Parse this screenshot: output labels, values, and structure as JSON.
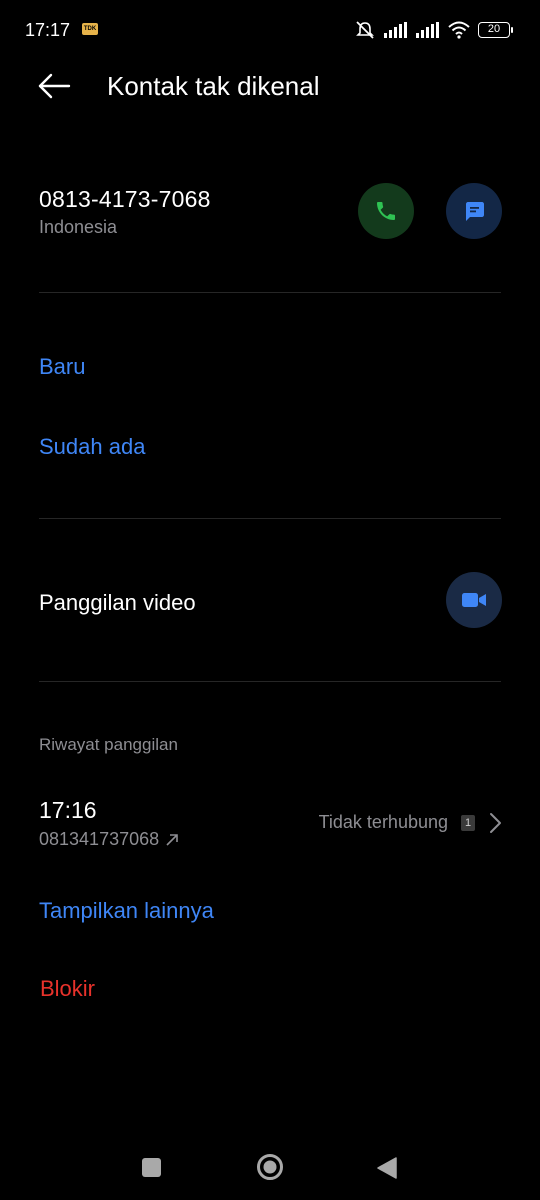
{
  "status_bar": {
    "time": "17:17",
    "app_badge": "TDK",
    "battery": "20"
  },
  "header": {
    "title": "Kontak tak dikenal"
  },
  "contact": {
    "number": "0813-4173-7068",
    "region": "Indonesia"
  },
  "add_options": {
    "new_label": "Baru",
    "existing_label": "Sudah ada"
  },
  "video": {
    "label": "Panggilan video"
  },
  "history": {
    "section_title": "Riwayat panggilan",
    "items": [
      {
        "time": "17:16",
        "number": "081341737068",
        "status": "Tidak terhubung",
        "count": "1"
      }
    ],
    "show_more_label": "Tampilkan lainnya"
  },
  "block": {
    "label": "Blokir"
  },
  "colors": {
    "accent": "#3f86f6",
    "danger": "#e8322b",
    "call_green": "#2fc253",
    "background": "#000000"
  },
  "icons": [
    "back-arrow-icon",
    "phone-icon",
    "message-icon",
    "video-camera-icon",
    "outgoing-arrow-icon",
    "chevron-right-icon",
    "mute-icon",
    "signal-icon",
    "wifi-icon",
    "battery-icon"
  ]
}
